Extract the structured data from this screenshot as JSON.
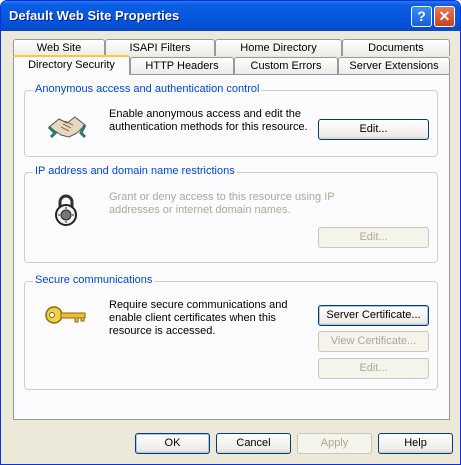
{
  "window": {
    "title": "Default Web Site Properties"
  },
  "titlebar": {
    "help_label": "?",
    "close_label": "✕"
  },
  "tabs": {
    "row_back": [
      "Web Site",
      "ISAPI Filters",
      "Home Directory",
      "Documents"
    ],
    "row_front": [
      "Directory Security",
      "HTTP Headers",
      "Custom Errors",
      "Server Extensions"
    ],
    "active": "Directory Security"
  },
  "anonymous": {
    "legend": "Anonymous access and authentication control",
    "text": "Enable anonymous access and edit the authentication methods for this resource.",
    "edit_label": "Edit..."
  },
  "ip": {
    "legend": "IP address and domain name restrictions",
    "text": "Grant or deny access to this resource using IP addresses or internet domain names.",
    "edit_label": "Edit..."
  },
  "secure": {
    "legend": "Secure communications",
    "text": "Require secure communications and enable client certificates when this resource is accessed.",
    "server_cert_label": "Server Certificate...",
    "view_cert_label": "View Certificate...",
    "edit_label": "Edit..."
  },
  "footer": {
    "ok_label": "OK",
    "cancel_label": "Cancel",
    "apply_label": "Apply",
    "help_label": "Help"
  },
  "icons": {
    "handshake": "handshake-icon",
    "lock": "padlock-icon",
    "key": "key-icon"
  }
}
